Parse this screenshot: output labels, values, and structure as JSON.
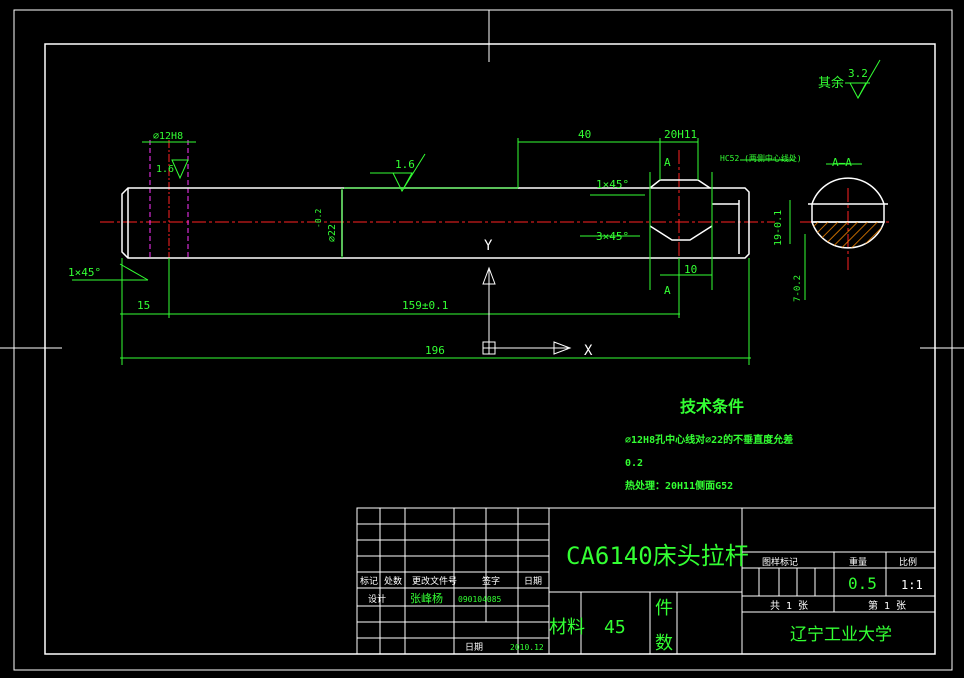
{
  "colors": {
    "background": "#000000",
    "outline": "#ffffff",
    "dimension": "#33ff33",
    "centerline": "#ff2222",
    "hidden": "#ff33ff",
    "hatch": "#ff8c00"
  },
  "roughness": {
    "prefix": "其余",
    "value": "3.2",
    "surface_1": "1.6",
    "surface_2": "1.6"
  },
  "dimensions": {
    "bore": "⌀12H8",
    "length_40": "40",
    "groove_width": "20H11",
    "chamfer_1": "1×45°",
    "chamfer_2": "1×45°",
    "chamfer_3": "3×45°",
    "diameter_22": "⌀22",
    "tol_22": "-0.2",
    "length_15": "15",
    "length_159": "159±0.1",
    "length_196": "196",
    "length_10": "10",
    "section_depth": "19-0.1",
    "key_width": "7-0.2",
    "note_c52": "HC52 (两侧中心线处)"
  },
  "section": {
    "marker": "A",
    "marker_2": "A",
    "label": "A—A"
  },
  "ucs": {
    "y": "Y",
    "x": "X"
  },
  "tech_requirements": {
    "title": "技术条件",
    "line1": "⌀12H8孔中心线对⌀22的不垂直度允差",
    "line2": "0.2",
    "line3": "热处理：20H11侧面G52"
  },
  "title_block": {
    "part_name": "CA6140床头拉杆",
    "h_mark": "标记",
    "h_count": "处数",
    "h_doc": "更改文件号",
    "h_sign": "签字",
    "h_date": "日期",
    "design_label": "设计",
    "designer": "张峰杨",
    "student_id": "090104085",
    "date_label": "日期",
    "date": "2010.12",
    "material_label": "材料",
    "material_value": "45",
    "qty_label_1": "件",
    "qty_label_2": "数",
    "h_stage": "图样标记",
    "h_weight": "重量",
    "h_scale": "比例",
    "weight": "0.5",
    "scale": "1:1",
    "total_sheets": "共 1 张",
    "sheet_no": "第 1 张",
    "school": "辽宁工业大学"
  }
}
